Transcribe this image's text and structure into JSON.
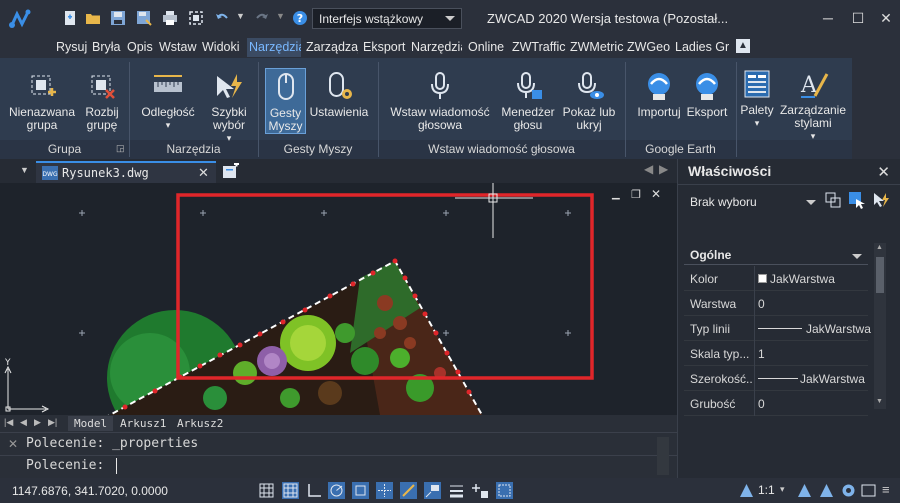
{
  "titlebar": {
    "workspace": "Interfejs wstążkowy",
    "title": "ZWCAD 2020 Wersja testowa (Pozostał..."
  },
  "menu": {
    "items": [
      "Rysuj",
      "Bryła",
      "Opis",
      "Wstaw",
      "Widoki",
      "Narzędzia",
      "Zarządzaj",
      "Eksport",
      "Narzędzia",
      "Online",
      "ZWTraffic",
      "ZWMetric",
      "ZWGeo",
      "Ladies Gr"
    ],
    "active_index": 5
  },
  "ribbon": {
    "buttons": [
      {
        "label": "Nienazwana grupa"
      },
      {
        "label": "Rozbij grupę"
      },
      {
        "label": "Odległość"
      },
      {
        "label": "Szybki wybór"
      },
      {
        "label": "Gesty Myszy"
      },
      {
        "label": "Ustawienia"
      },
      {
        "label": "Wstaw wiadomość głosowa"
      },
      {
        "label": "Menedżer głosu"
      },
      {
        "label": "Pokaż lub ukryj"
      },
      {
        "label": "Importuj"
      },
      {
        "label": "Eksport"
      },
      {
        "label": "Palety"
      },
      {
        "label": "Zarządzanie stylami"
      }
    ],
    "panels": [
      "Grupa",
      "Narzędzia",
      "Gesty Myszy",
      "Wstaw wiadomość głosowa",
      "Google Earth"
    ]
  },
  "document_tab": {
    "label": "Rysunek3.dwg"
  },
  "layout_tabs": [
    "Model",
    "Arkusz1",
    "Arkusz2"
  ],
  "command": {
    "history": "Polecenie: _properties",
    "prompt": "Polecenie:"
  },
  "status": {
    "coords": "1147.6876, 341.7020, 0.0000",
    "scale": "1:1"
  },
  "properties": {
    "title": "Właściwości",
    "selection": "Brak wyboru",
    "section": "Ogólne",
    "rows": [
      {
        "label": "Kolor",
        "value": "JakWarstwa"
      },
      {
        "label": "Warstwa",
        "value": "0"
      },
      {
        "label": "Typ linii",
        "value": "JakWarstwa"
      },
      {
        "label": "Skala typ...",
        "value": "1"
      },
      {
        "label": "Szerokość...",
        "value": "JakWarstwa"
      },
      {
        "label": "Grubość",
        "value": "0"
      }
    ]
  },
  "drawing": {
    "axis_label": "Y",
    "highlight_color": "#e0262a",
    "accent": "#3a8ee6"
  }
}
